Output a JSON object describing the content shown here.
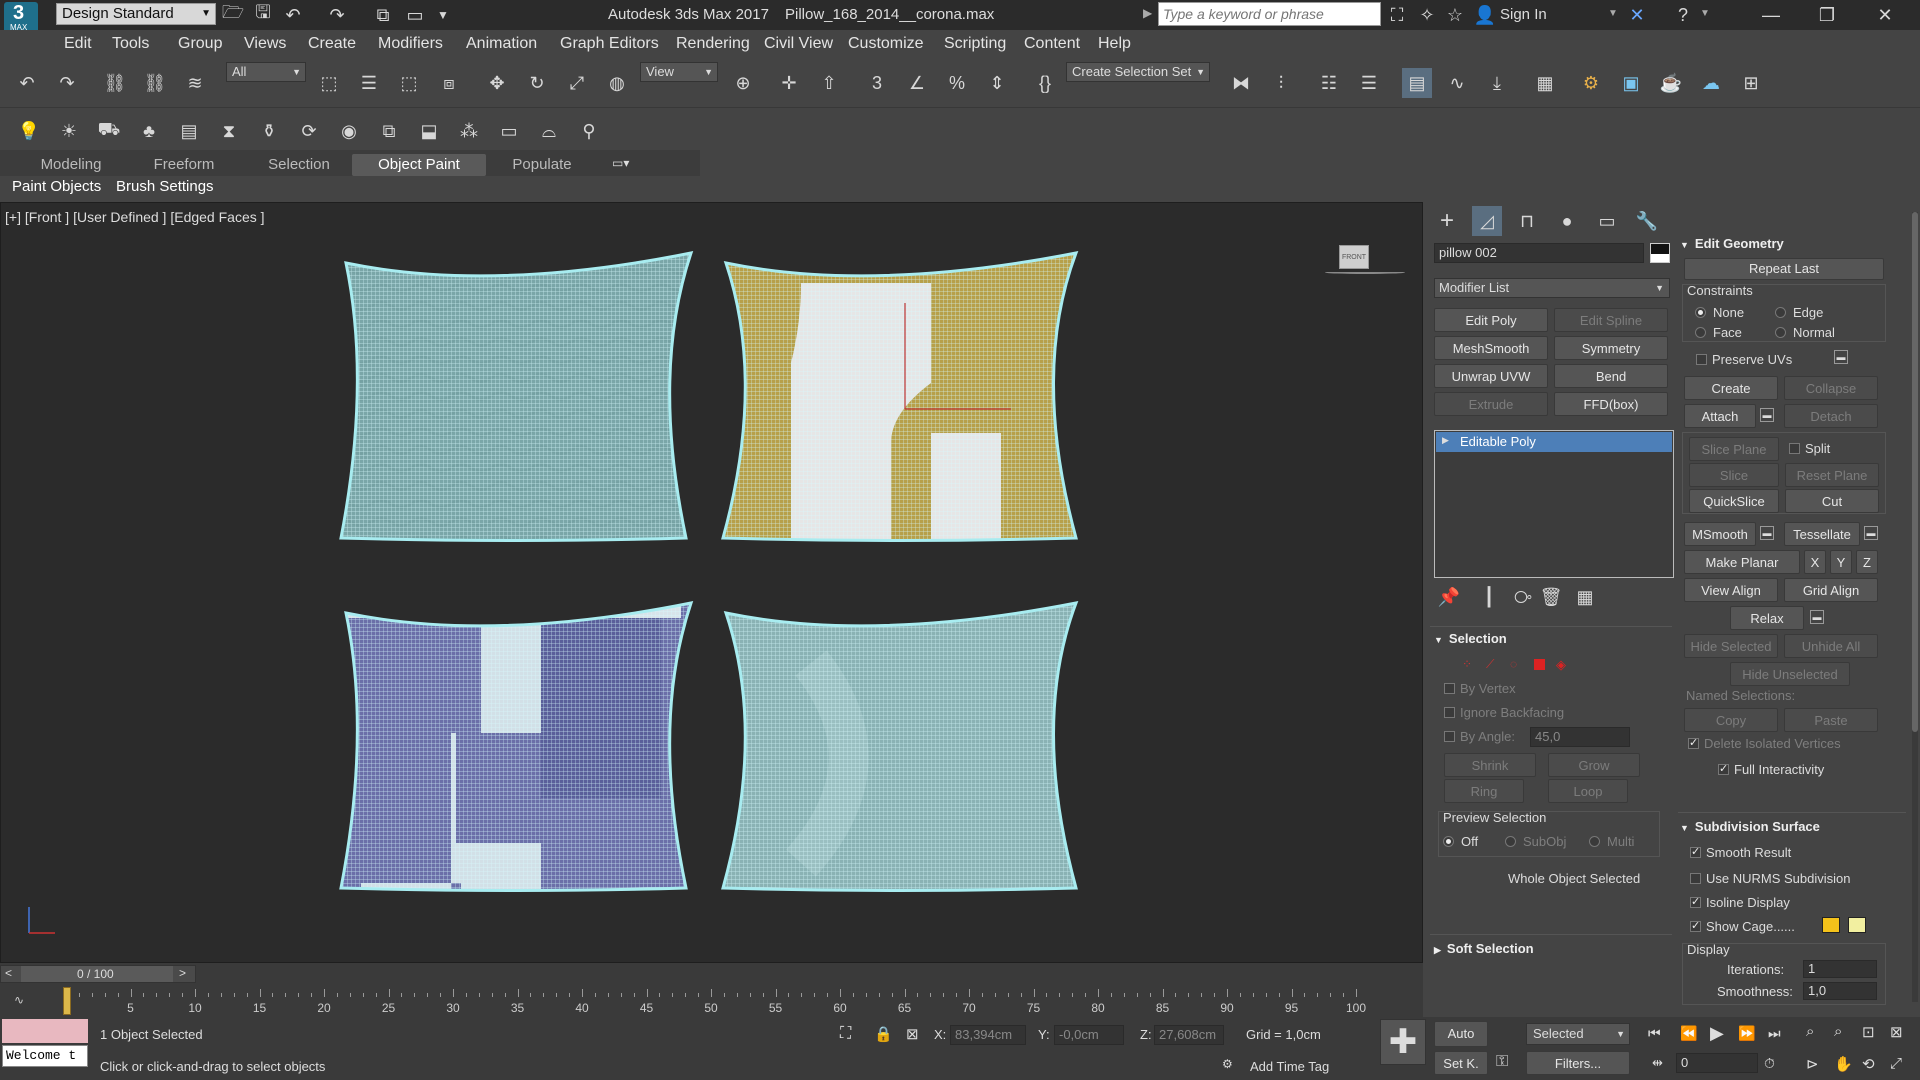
{
  "title_bar": {
    "logo_text": "MAX",
    "workspace": "Design Standard",
    "app_title": "Autodesk 3ds Max 2017",
    "file_name": "Pillow_168_2014__corona.max",
    "search_placeholder": "Type a keyword or phrase",
    "sign_in": "Sign In"
  },
  "menu": [
    "Edit",
    "Tools",
    "Group",
    "Views",
    "Create",
    "Modifiers",
    "Animation",
    "Graph Editors",
    "Rendering",
    "Civil View",
    "Customize",
    "Scripting",
    "Content",
    "Help"
  ],
  "toolbar": {
    "filter_value": "All",
    "ref_coord_value": "View",
    "selection_set_value": "Create Selection Set"
  },
  "ribbon_tabs": [
    "Modeling",
    "Freeform",
    "Selection",
    "Object Paint",
    "Populate"
  ],
  "ribbon_active": "Object Paint",
  "sub_tabs": [
    "Paint Objects",
    "Brush Settings"
  ],
  "viewport": {
    "label": "[+] [Front ] [User Defined ] [Edged Faces ]",
    "viewcube_label": "FRONT",
    "wire_color": "#a8ecf0",
    "pillows": [
      {
        "name": "pillow-top-left",
        "fabric": "#7aa6a8",
        "patches": []
      },
      {
        "name": "pillow-top-right",
        "fabric": "#b7a04a",
        "patches": [
          "white"
        ]
      },
      {
        "name": "pillow-bottom-left",
        "fabric": "#6b6fa8",
        "patches": [
          "white"
        ]
      },
      {
        "name": "pillow-bottom-right",
        "fabric": "#8ab2b4",
        "patches": []
      }
    ]
  },
  "command_panel": {
    "object_name": "pillow 002",
    "modifier_list": "Modifier List",
    "modifier_buttons": [
      {
        "label": "Edit Poly",
        "enabled": true
      },
      {
        "label": "Edit Spline",
        "enabled": false
      },
      {
        "label": "MeshSmooth",
        "enabled": true
      },
      {
        "label": "Symmetry",
        "enabled": true
      },
      {
        "label": "Unwrap UVW",
        "enabled": true
      },
      {
        "label": "Bend",
        "enabled": true
      },
      {
        "label": "Extrude",
        "enabled": false
      },
      {
        "label": "FFD(box)",
        "enabled": true
      }
    ],
    "stack_item": "Editable Poly",
    "selection": {
      "title": "Selection",
      "by_vertex": "By Vertex",
      "ignore_backfacing": "Ignore Backfacing",
      "by_angle": "By Angle:",
      "angle_value": "45,0",
      "shrink": "Shrink",
      "grow": "Grow",
      "ring": "Ring",
      "loop": "Loop",
      "preview_title": "Preview Selection",
      "preview_off": "Off",
      "preview_subobj": "SubObj",
      "preview_multi": "Multi",
      "status": "Whole Object Selected"
    },
    "soft_selection": "Soft Selection",
    "edit_geometry": {
      "title": "Edit Geometry",
      "repeat_last": "Repeat Last",
      "constraints": "Constraints",
      "none": "None",
      "edge": "Edge",
      "face": "Face",
      "normal": "Normal",
      "preserve_uvs": "Preserve UVs",
      "create": "Create",
      "collapse": "Collapse",
      "attach": "Attach",
      "detach": "Detach",
      "slice_plane": "Slice Plane",
      "split": "Split",
      "slice": "Slice",
      "reset_plane": "Reset Plane",
      "quickslice": "QuickSlice",
      "cut": "Cut",
      "msmooth": "MSmooth",
      "tessellate": "Tessellate",
      "make_planar": "Make Planar",
      "x": "X",
      "y": "Y",
      "z": "Z",
      "view_align": "View Align",
      "grid_align": "Grid Align",
      "relax": "Relax",
      "hide_selected": "Hide Selected",
      "unhide_all": "Unhide All",
      "hide_unselected": "Hide Unselected",
      "named_selections": "Named Selections:",
      "copy": "Copy",
      "paste": "Paste",
      "delete_isolated": "Delete Isolated Vertices",
      "full_interactivity": "Full Interactivity"
    },
    "subdivision": {
      "title": "Subdivision Surface",
      "smooth_result": "Smooth Result",
      "use_nurms": "Use NURMS Subdivision",
      "isoline_display": "Isoline Display",
      "show_cage": "Show Cage......",
      "display": "Display",
      "iterations_label": "Iterations:",
      "iterations_value": "1",
      "smoothness_label": "Smoothness:",
      "smoothness_value": "1,0",
      "cage_color_1": "#f4c21a",
      "cage_color_2": "#f2efa0"
    }
  },
  "timeline": {
    "frame_display": "0 / 100",
    "ticks": [
      "0",
      "5",
      "10",
      "15",
      "20",
      "25",
      "30",
      "35",
      "40",
      "45",
      "50",
      "55",
      "60",
      "65",
      "70",
      "75",
      "80",
      "85",
      "90",
      "95",
      "100"
    ]
  },
  "status": {
    "welcome": "Welcome t",
    "selected": "1 Object Selected",
    "prompt": "Click or click-and-drag to select objects",
    "x_label": "X:",
    "x_value": "83,394cm",
    "y_label": "Y:",
    "y_value": "-0,0cm",
    "z_label": "Z:",
    "z_value": "27,608cm",
    "grid": "Grid = 1,0cm",
    "add_time_tag": "Add Time Tag",
    "auto": "Auto",
    "set_key": "Set K.",
    "selected_dropdown": "Selected",
    "filters": "Filters...",
    "frame_value": "0"
  }
}
